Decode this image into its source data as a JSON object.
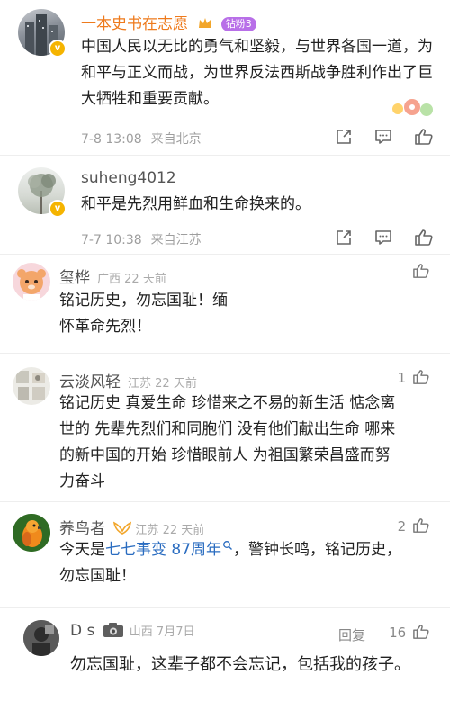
{
  "colors": {
    "vip_name": "#ee7a1c",
    "link": "#2a6cc0",
    "meta": "#9e9e9e"
  },
  "comments": [
    {
      "name": "一本史书在志愿",
      "badge": "钻粉3",
      "text": "中国人民以无比的勇气和坚毅，与世界各国一道，为和平与正义而战，为世界反法西斯战争胜利作出了巨大牺牲和重要贡献。",
      "date": "7-8 13:08",
      "location": "来自北京",
      "actions": [
        "share-icon",
        "comment-icon",
        "like-icon"
      ]
    },
    {
      "name": "suheng4012",
      "text": "和平是先烈用鲜血和生命换来的。",
      "date": "7-7 10:38",
      "location": "来自江苏",
      "actions": [
        "share-icon",
        "comment-icon",
        "like-icon"
      ]
    }
  ],
  "replies": [
    {
      "name": "玺桦",
      "location": "广西",
      "time": "22 天前",
      "text": "铭记历史，勿忘国耻！缅怀革命先烈！",
      "likes": ""
    },
    {
      "name": "云淡风轻",
      "location": "江苏",
      "time": "22 天前",
      "text": "铭记历史 真爱生命 珍惜来之不易的新生活 惦念离世的 先辈先烈们和同胞们 没有他们献出生命 哪来的新中国的开始 珍惜眼前人 为祖国繁荣昌盛而努力奋斗",
      "likes": "1"
    },
    {
      "name": "养鸟者",
      "location": "江苏",
      "time": "22 天前",
      "text_before": "今天是",
      "topic": "七七事变 87周年",
      "text_after": "，警钟长鸣，铭记历史，勿忘国耻！",
      "likes": "2"
    },
    {
      "name": "D s",
      "location": "山西",
      "time": "7月7日",
      "reply_label": "回复",
      "text": "勿忘国耻，这辈子都不会忘记，包括我的孩子。",
      "likes": "16"
    }
  ]
}
